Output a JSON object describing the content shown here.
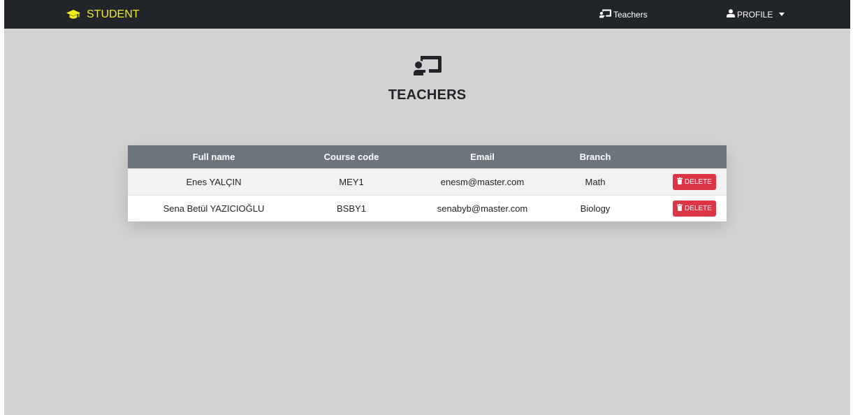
{
  "nav": {
    "brand_label": "STUDENT",
    "brand_icon": "graduation-cap-icon",
    "teachers_label": "Teachers",
    "teachers_icon": "chalkboard-teacher-icon",
    "profile_label": "PROFILE",
    "profile_icon": "user-icon"
  },
  "page": {
    "title": "TEACHERS",
    "icon": "chalkboard-teacher-icon"
  },
  "table": {
    "headers": [
      "Full name",
      "Course code",
      "Email",
      "Branch"
    ],
    "rows": [
      {
        "full_name": "Enes YALÇIN",
        "course_code": "MEY1",
        "email": "enesm@master.com",
        "branch": "Math",
        "action": "DELETE"
      },
      {
        "full_name": "Sena Betül YAZICIOĞLU",
        "course_code": "BSBY1",
        "email": "senabyb@master.com",
        "branch": "Biology",
        "action": "DELETE"
      }
    ]
  },
  "colors": {
    "navbar_bg": "#212529",
    "brand": "#f2ec1c",
    "page_bg": "#d3d3d3",
    "table_header_bg": "#6c757d",
    "danger": "#dc3545"
  }
}
